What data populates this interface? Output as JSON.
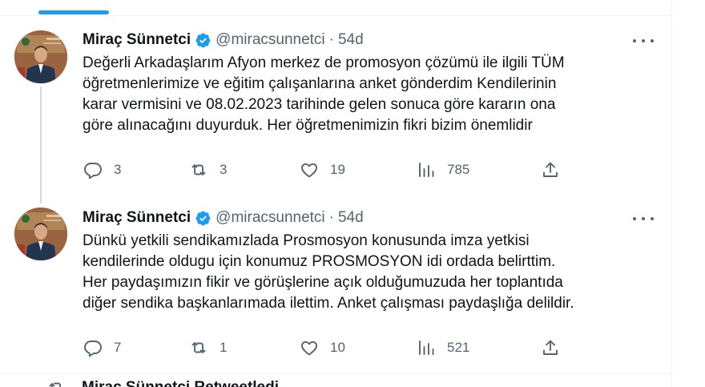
{
  "tweets": [
    {
      "name": "Miraç Sünnetci",
      "handle": "@miracsunnetci",
      "separator": "·",
      "time": "54d",
      "text_lines": [
        "Değerli Arkadaşlarım Afyon merkez de promosyon çözümü  ile ilgili TÜM",
        "öğretmenlerimize ve eğitim çalışanlarına anket gönderdim Kendilerinin",
        "karar vermisini ve 08.02.2023  tarihinde gelen sonuca göre kararın ona",
        "göre alınacağını duyurduk. Her öğretmenimizin fikri bizim önemlidir"
      ],
      "replies": "3",
      "retweets": "3",
      "likes": "19",
      "views": "785"
    },
    {
      "name": "Miraç Sünnetci",
      "handle": "@miracsunnetci",
      "separator": "·",
      "time": "54d",
      "text_lines": [
        "Dünkü yetkili sendikamızlada Prosmosyon konusunda imza yetkisi",
        "kendilerinde oldugu için konumuz PROSMOSYON  idi ordada belirttim.",
        "Her paydaşımızın fikir ve görüşlerine açık olduğumuzuda her toplantıda",
        "diğer sendika başkanlarımada ilettim. Anket çalışması paydaşlığa delildir."
      ],
      "replies": "7",
      "retweets": "1",
      "likes": "10",
      "views": "521"
    }
  ],
  "next_row_text": "Miraç Sünnetci Retweetledi",
  "colors": {
    "accent": "#1d9bf0",
    "text": "#0f1419",
    "secondary": "#536471",
    "border": "#eff3f4",
    "thread_line": "#cfd9de"
  },
  "icons": [
    "verified-badge-icon",
    "more-icon",
    "reply-icon",
    "retweet-icon",
    "like-icon",
    "views-icon",
    "share-icon"
  ]
}
